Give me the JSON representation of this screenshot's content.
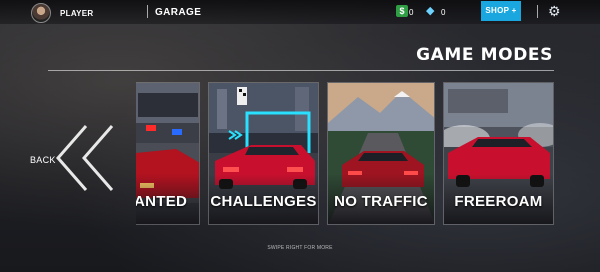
{
  "header": {
    "player_name": "PLAYER",
    "screen_title": "GARAGE",
    "cash_symbol": "$",
    "cash": "0",
    "gems": "0",
    "shop_label": "SHOP +"
  },
  "main": {
    "title": "GAME MODES",
    "back_label": "BACK",
    "swipe_hint": "SWIPE RIGHT FOR MORE",
    "modes": [
      {
        "label": "ANTED"
      },
      {
        "label": "CHALLENGES"
      },
      {
        "label": "NO TRAFFIC"
      },
      {
        "label": "FREEROAM"
      }
    ]
  },
  "colors": {
    "accent": "#1aa7e0",
    "cash": "#2f9e44",
    "car_red": "#c8102e"
  },
  "icons": [
    "avatar",
    "cash-icon",
    "gem-icon",
    "gear-icon",
    "back-chevron-icon"
  ]
}
